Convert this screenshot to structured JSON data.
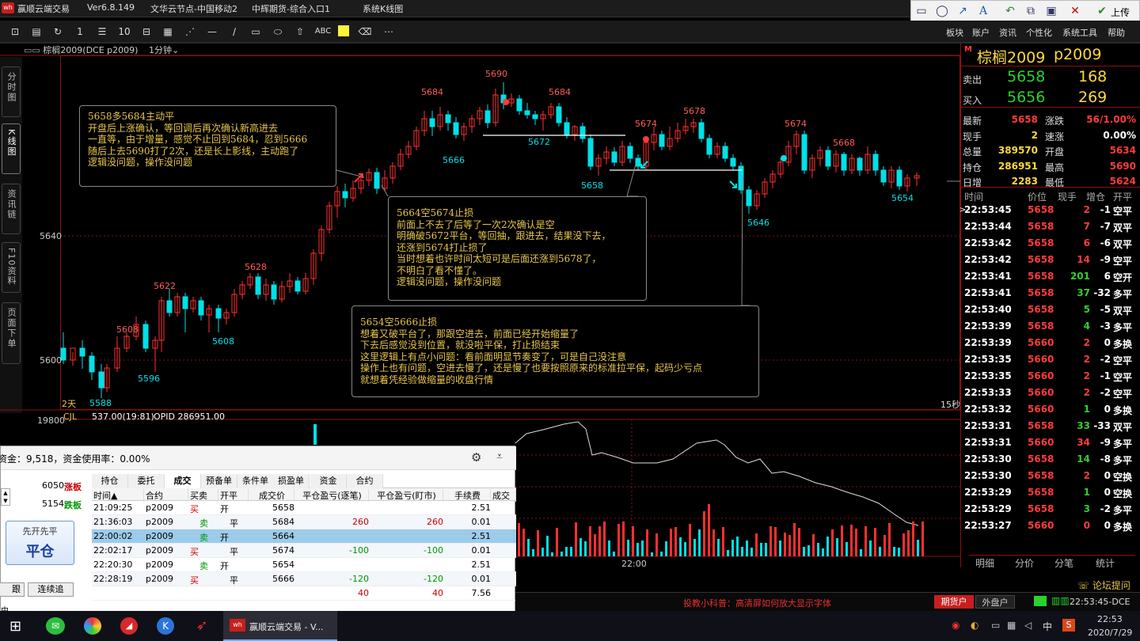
{
  "titlebar": {
    "app": "赢顺云端交易",
    "version": "Ver6.8.149",
    "node": "文华云节点-中国移动2",
    "broker": "中辉期货-综合入口1",
    "window": "系统K线图"
  },
  "drawtoolbar": {
    "upload": "上传"
  },
  "toolbar": {
    "text_tool": "ABC"
  },
  "menu": [
    "板块",
    "账户",
    "资讯",
    "个性化",
    "系统工具",
    "帮助"
  ],
  "leftnav": [
    "分时图",
    "K线图",
    "资讯链",
    "F10资料",
    "页面下单"
  ],
  "chart_header": {
    "symbol": "棕榈2009(DCE p2009)",
    "period": "1分钟"
  },
  "chart": {
    "period_days": "2天",
    "interval": "15秒",
    "price_ticks": [
      "5640",
      "5600"
    ],
    "vol_tick": "19800",
    "time_tick": "22:00",
    "indicator": "CJL",
    "vol_value": "537.00(19:81)",
    "opid": "OPID 286951.00",
    "price_labels": [
      "5690",
      "5684",
      "5684",
      "5674",
      "5678",
      "5674",
      "5668",
      "5672",
      "5666",
      "5658",
      "5646",
      "5654",
      "5622",
      "5628",
      "5608",
      "5608",
      "5596",
      "5588"
    ]
  },
  "chart_data": {
    "type": "candlestick",
    "yticks": [
      5600,
      5640
    ],
    "annotated_highs": [
      5690,
      5684,
      5684,
      5674,
      5678,
      5674,
      5668,
      5622,
      5628,
      5608
    ],
    "annotated_lows": [
      5672,
      5666,
      5658,
      5646,
      5654,
      5608,
      5596,
      5588
    ]
  },
  "notes": [
    {
      "lines": [
        "5658多5684主动平",
        "开盘后上涨确认，等回调后再次确认新高进去",
        "一直等，由于增量，感觉不止回到5684，忍到5666",
        "随后上去5690打了2次，还是长上影线，主动跑了",
        "逻辑没问题，操作没问题"
      ]
    },
    {
      "lines": [
        "5664空5674止损",
        "前面上不去了后等了一次2次确认是空",
        "明确破5672平台，等回抽，跟进去，结果没下去，",
        "还涨到5674打止损了",
        "当时想着也许时间太短可是后面还涨到5678了，",
        "不明白了看不懂了。",
        "逻辑没问题，操作没问题"
      ]
    },
    {
      "lines": [
        "5654空5666止损",
        "想着又破平台了，那跟空进去，前面已经开始缩量了",
        "下去后感觉没到位置，就没啦平保，打止损结束",
        "这里逻辑上有点小问题：看前面明显节奏变了，可是自己没注意",
        "操作上也有问题，空进去慢了，还是慢了也要按照原来的标准拉平保，起码少亏点",
        "就想着凭经验做缩量的收盘行情"
      ]
    }
  ],
  "quote": {
    "flag": "M",
    "name": "棕榈2009",
    "code": "p2009",
    "sell": {
      "label": "卖出",
      "price": "5658",
      "vol": "168"
    },
    "buy": {
      "label": "买入",
      "price": "5656",
      "vol": "269"
    },
    "stats": [
      [
        "最新",
        "5658",
        "涨跌",
        "56/1.00%"
      ],
      [
        "现手",
        "2",
        "速涨",
        "0.00%"
      ],
      [
        "总量",
        "389570",
        "开盘",
        "5634"
      ],
      [
        "持仓",
        "286951",
        "最高",
        "5690"
      ],
      [
        "日增",
        "2283",
        "最低",
        "5624"
      ]
    ],
    "tick_headers": [
      "时间",
      "价位",
      "现手",
      "增仓",
      "开平"
    ],
    "ticks": [
      [
        "22:53:45",
        "5658",
        "2",
        "-1",
        "空平"
      ],
      [
        "22:53:44",
        "5658",
        "7",
        "-7",
        "双平"
      ],
      [
        "22:53:42",
        "5658",
        "6",
        "-6",
        "双平"
      ],
      [
        "22:53:42",
        "5658",
        "14",
        "-9",
        "空平"
      ],
      [
        "22:53:41",
        "5658",
        "201",
        "6",
        "空开"
      ],
      [
        "22:53:41",
        "5658",
        "37",
        "-32",
        "多平"
      ],
      [
        "22:53:40",
        "5658",
        "5",
        "-5",
        "双平"
      ],
      [
        "22:53:39",
        "5658",
        "4",
        "-3",
        "多平"
      ],
      [
        "22:53:39",
        "5660",
        "2",
        "0",
        "多换"
      ],
      [
        "22:53:35",
        "5660",
        "2",
        "-2",
        "空平"
      ],
      [
        "22:53:35",
        "5660",
        "2",
        "-1",
        "空平"
      ],
      [
        "22:53:33",
        "5660",
        "2",
        "-2",
        "空平"
      ],
      [
        "22:53:32",
        "5660",
        "1",
        "0",
        "多换"
      ],
      [
        "22:53:31",
        "5658",
        "33",
        "-33",
        "双平"
      ],
      [
        "22:53:31",
        "5660",
        "34",
        "-9",
        "多平"
      ],
      [
        "22:53:30",
        "5658",
        "14",
        "-8",
        "多平"
      ],
      [
        "22:53:30",
        "5658",
        "2",
        "0",
        "空换"
      ],
      [
        "22:53:29",
        "5658",
        "1",
        "0",
        "空换"
      ],
      [
        "22:53:29",
        "5658",
        "3",
        "-2",
        "多平"
      ],
      [
        "22:53:27",
        "5660",
        "0",
        "0",
        "多换"
      ]
    ],
    "bottom_tabs": [
      "明细",
      "分价",
      "分笔",
      "统计"
    ]
  },
  "trade": {
    "funds": "资金：9,518，资金使用率：0.00%",
    "limit_up_price": "6050",
    "limit_up": "涨板",
    "limit_down_price": "5154",
    "limit_down": "跌板",
    "btn_top": "先开先平",
    "btn_main": "平仓",
    "btn_follow": "跟",
    "btn_chase": "连续追",
    "bottom_cut": "中",
    "tabs": [
      "持仓",
      "委托",
      "成交",
      "预备单",
      "条件单",
      "损盈单",
      "资金",
      "合约"
    ],
    "headers": [
      "时间▲",
      "合约",
      "买卖",
      "开平",
      "成交价",
      "平仓盈亏(逐笔)",
      "平仓盈亏(盯市)",
      "手续费",
      "成交"
    ],
    "rows": [
      [
        "21:09:25",
        "p2009",
        "买",
        "开",
        "5658",
        "",
        "",
        "2.51"
      ],
      [
        "21:36:03",
        "p2009",
        "卖",
        "平",
        "5684",
        "260",
        "260",
        "0.01"
      ],
      [
        "22:00:02",
        "p2009",
        "卖",
        "开",
        "5664",
        "",
        "",
        "2.51"
      ],
      [
        "22:02:17",
        "p2009",
        "买",
        "平",
        "5674",
        "-100",
        "-100",
        "0.01"
      ],
      [
        "22:20:30",
        "p2009",
        "卖",
        "开",
        "5654",
        "",
        "",
        "2.51"
      ],
      [
        "22:28:19",
        "p2009",
        "买",
        "平",
        "5666",
        "-120",
        "-120",
        "0.01"
      ],
      [
        "",
        "",
        "",
        "",
        "",
        "40",
        "40",
        "7.56"
      ]
    ]
  },
  "status": {
    "tip": "投教小科普：高清屏如何放大显示字体",
    "futures": "期货户",
    "outer": "外盘户",
    "clock": "22:53:45-DCE",
    "forum": "论坛提问"
  },
  "taskbar": {
    "app": "赢顺云端交易 - V...",
    "ime": "中",
    "time": "22:53",
    "date": "2020/7/29"
  }
}
